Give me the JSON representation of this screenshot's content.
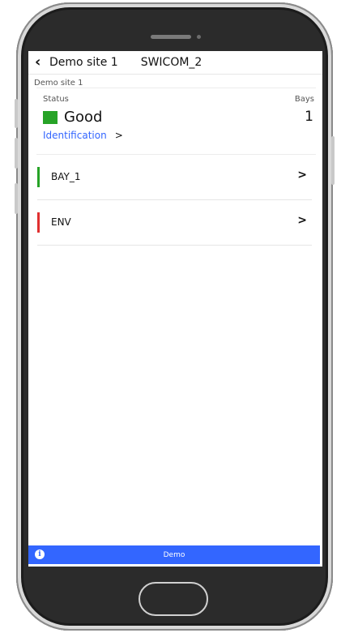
{
  "nav": {
    "back_label": "Demo site 1",
    "title": "SWICOM_2"
  },
  "breadcrumb": "Demo site 1",
  "summary": {
    "status_label": "Status",
    "status_value": "Good",
    "status_color": "#27a327",
    "bays_label": "Bays",
    "bays_value": "1",
    "identification_link": "Identification",
    "chevron": ">"
  },
  "items": [
    {
      "label": "BAY_1",
      "color": "#27a327",
      "chevron": ">"
    },
    {
      "label": "ENV",
      "color": "#e03030",
      "chevron": ">"
    }
  ],
  "footer": {
    "label": "Demo",
    "icon": "info-icon",
    "icon_glyph": "i",
    "color": "#3366ff"
  }
}
